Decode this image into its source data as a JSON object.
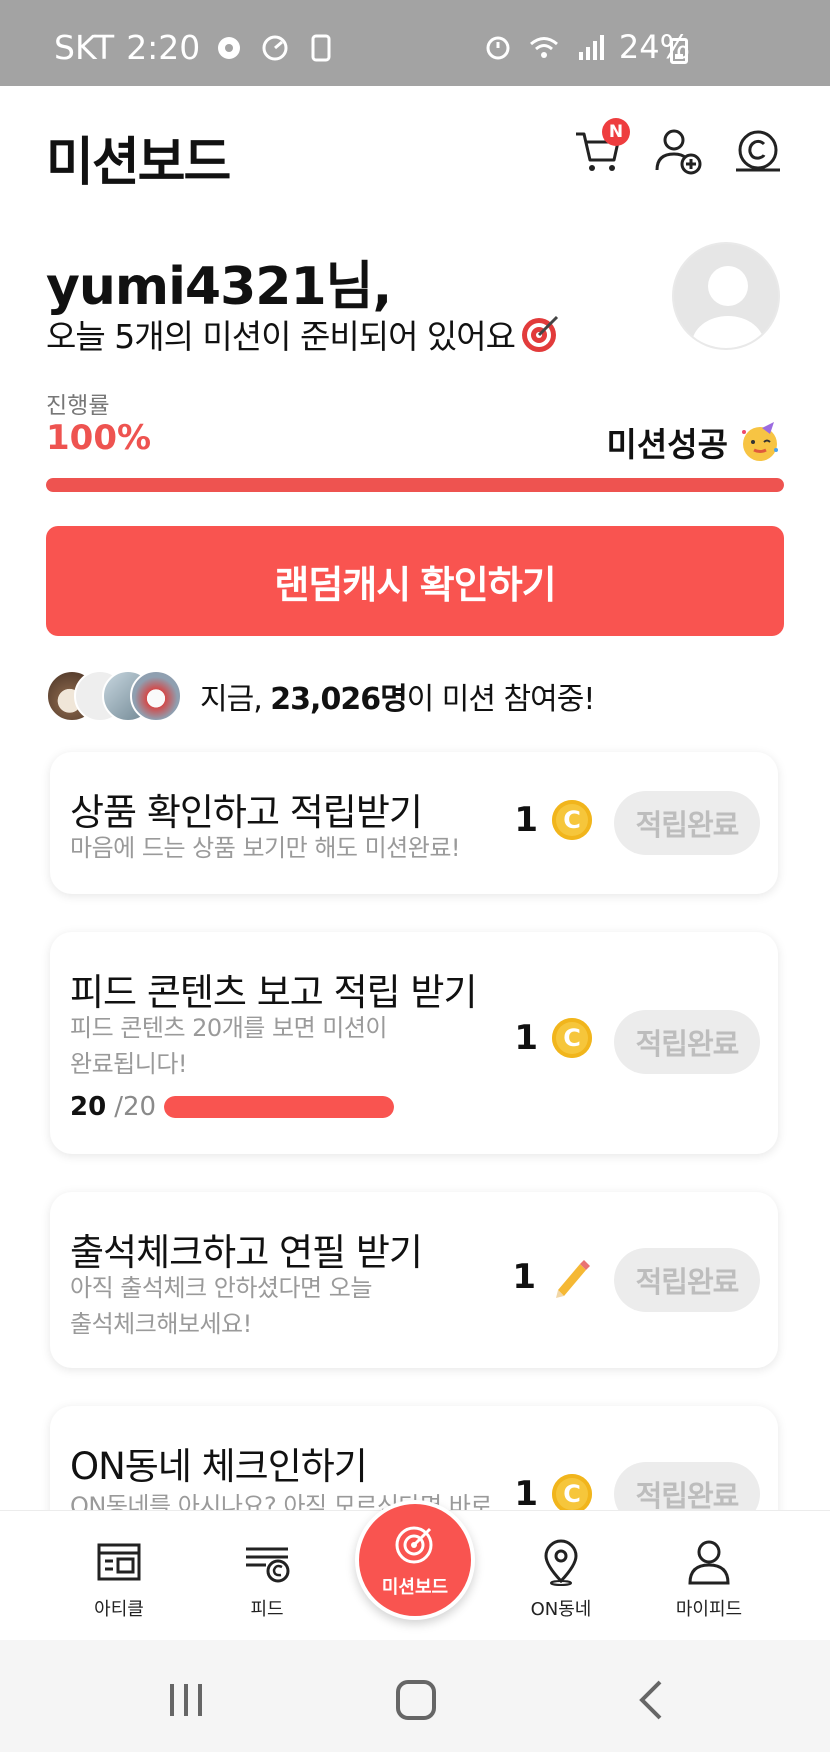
{
  "status_bar": {
    "carrier": "SKT",
    "time": "2:20",
    "battery_text": "24%"
  },
  "header": {
    "title": "미션보드",
    "cart_badge": "N"
  },
  "greeting": {
    "name": "yumi4321님,",
    "subtitle": "오늘 5개의 미션이 준비되어 있어요"
  },
  "progress": {
    "label": "진행률",
    "value_text": "100%",
    "fraction": 1.0,
    "success_text": "미션성공"
  },
  "random_cash_button": "랜덤캐시 확인하기",
  "participants": {
    "prefix": "지금,",
    "count": "23,026명",
    "suffix": "이 미션 참여중!"
  },
  "missions": [
    {
      "title": "상품 확인하고 적립받기",
      "description": "마음에 드는 상품 보기만 해도 미션완료!",
      "reward_amount": "1",
      "reward_icon": "coin-icon",
      "button_label": "적립완료"
    },
    {
      "title": "피드 콘텐츠 보고 적립 받기",
      "description": "피드 콘텐츠 20개를 보면 미션이 완료됩니다!",
      "progress_current": "20",
      "progress_total": "/20",
      "progress_fraction": 1.0,
      "reward_amount": "1",
      "reward_icon": "coin-icon",
      "button_label": "적립완료"
    },
    {
      "title": "출석체크하고 연필 받기",
      "description": "아직 출석체크 안하셨다면 오늘 출석체크해보세요!",
      "reward_amount": "1",
      "reward_icon": "pencil-icon",
      "button_label": "적립완료"
    },
    {
      "title": "ON동네 체크인하기",
      "description": "ON동네를 아시나요? 아직 모르신다면 바로",
      "reward_amount": "1",
      "reward_icon": "coin-icon",
      "button_label": "적립완료"
    }
  ],
  "bottom_nav": {
    "items": [
      "아티클",
      "피드",
      "미션보드",
      "ON동네",
      "마이피드"
    ]
  },
  "colors": {
    "accent": "#f95450",
    "progress_text": "#ee5350",
    "coin": "#f6c63b"
  }
}
